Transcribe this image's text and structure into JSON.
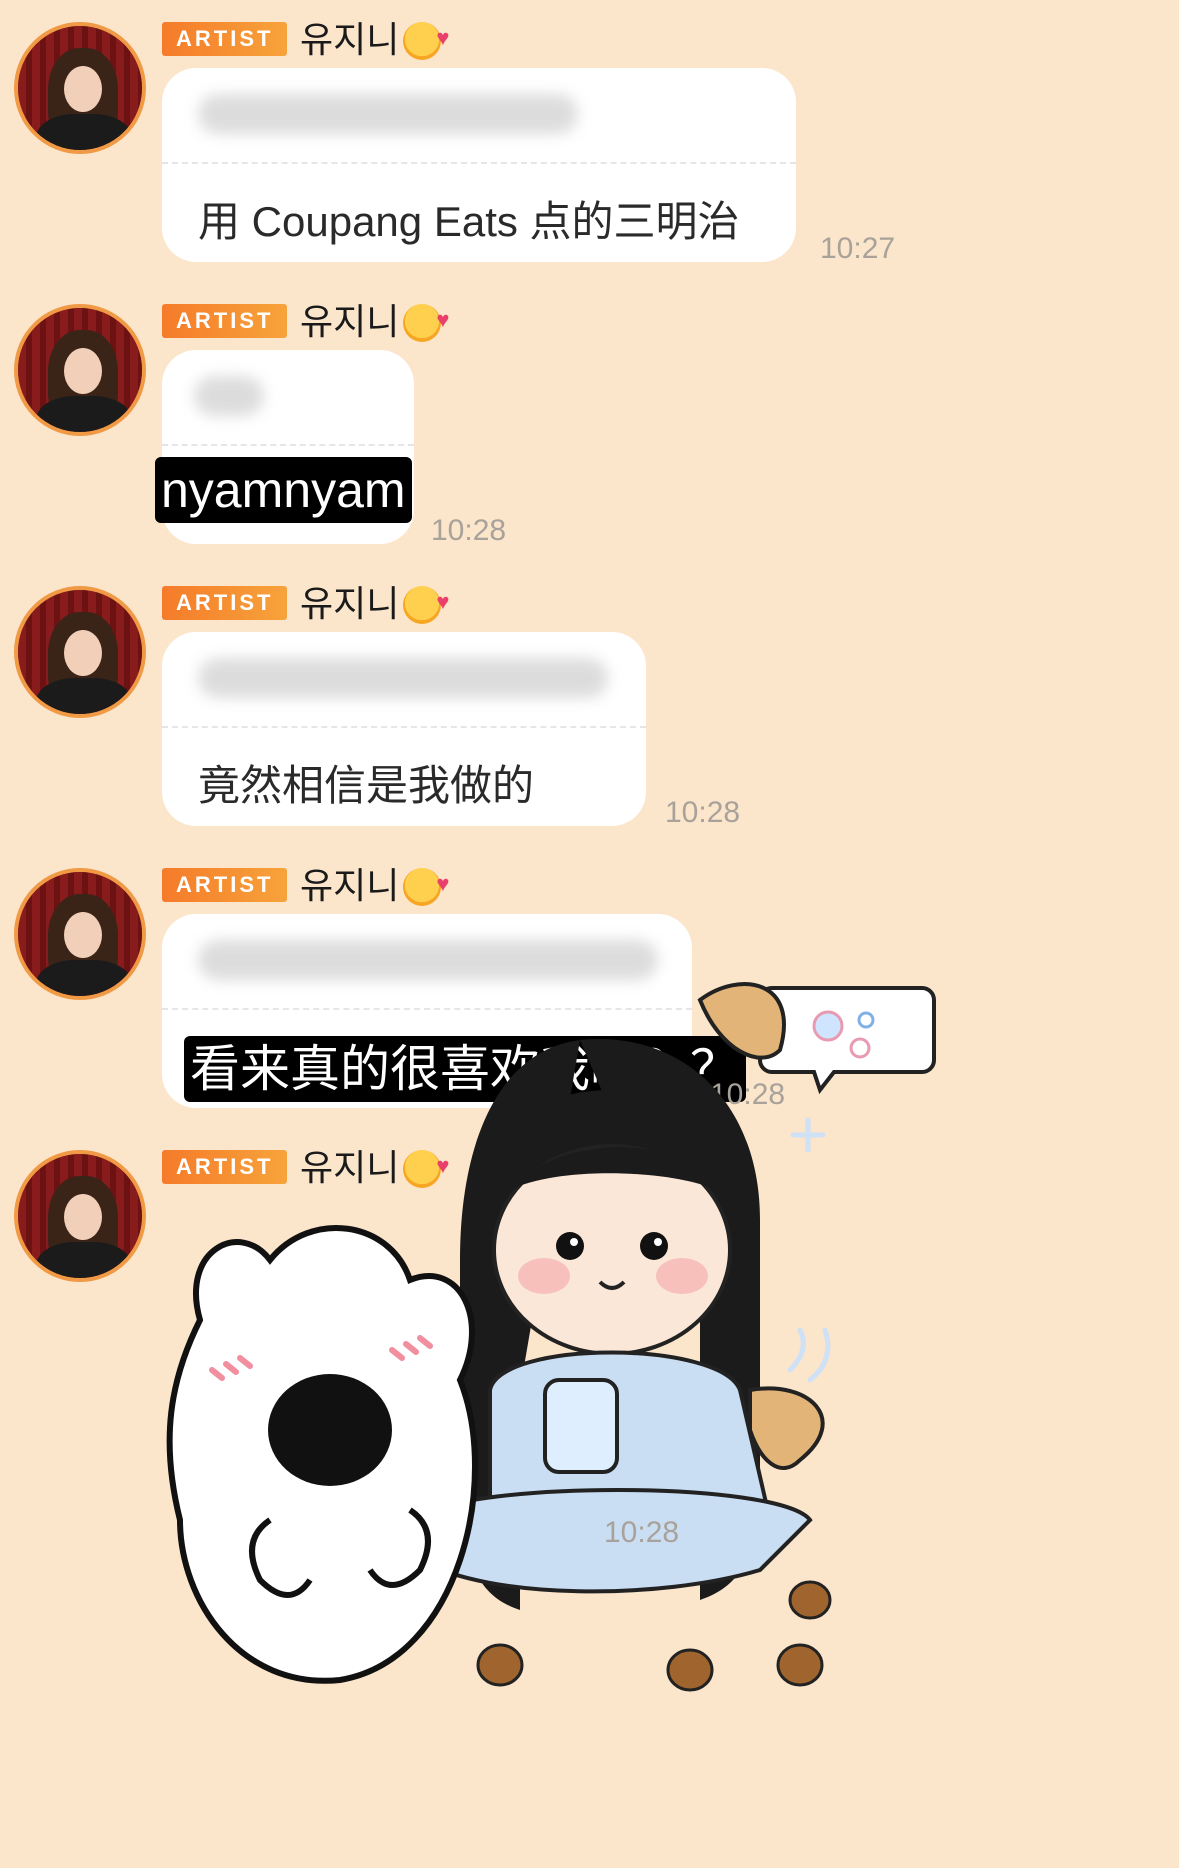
{
  "messages": [
    {
      "badge": "ARTIST",
      "sender": "유지니",
      "emoji": "smiling-face-with-hearts",
      "text": "用 Coupang Eats 点的三明治",
      "time": "10:27"
    },
    {
      "badge": "ARTIST",
      "sender": "유지니",
      "emoji": "smiling-face-with-hearts",
      "text": "nyamnyam",
      "time": "10:28"
    },
    {
      "badge": "ARTIST",
      "sender": "유지니",
      "emoji": "smiling-face-with-hearts",
      "text": "竟然相信是我做的",
      "time": "10:28"
    },
    {
      "badge": "ARTIST",
      "sender": "유지니",
      "emoji": "smiling-face-with-hearts",
      "text": "看来真的很喜欢我嘛？？",
      "time": "10:28"
    },
    {
      "badge": "ARTIST",
      "sender": "유지니",
      "emoji": "smiling-face-with-hearts",
      "sticker": "sticker-girl-dog-and-white-puppy",
      "time": "10:28"
    }
  ],
  "colors": {
    "background": "#fbe5cb",
    "badge": "#f57b2a",
    "bubble": "#ffffff",
    "time": "#a8a29a",
    "avatar_ring": "#f09a45"
  }
}
